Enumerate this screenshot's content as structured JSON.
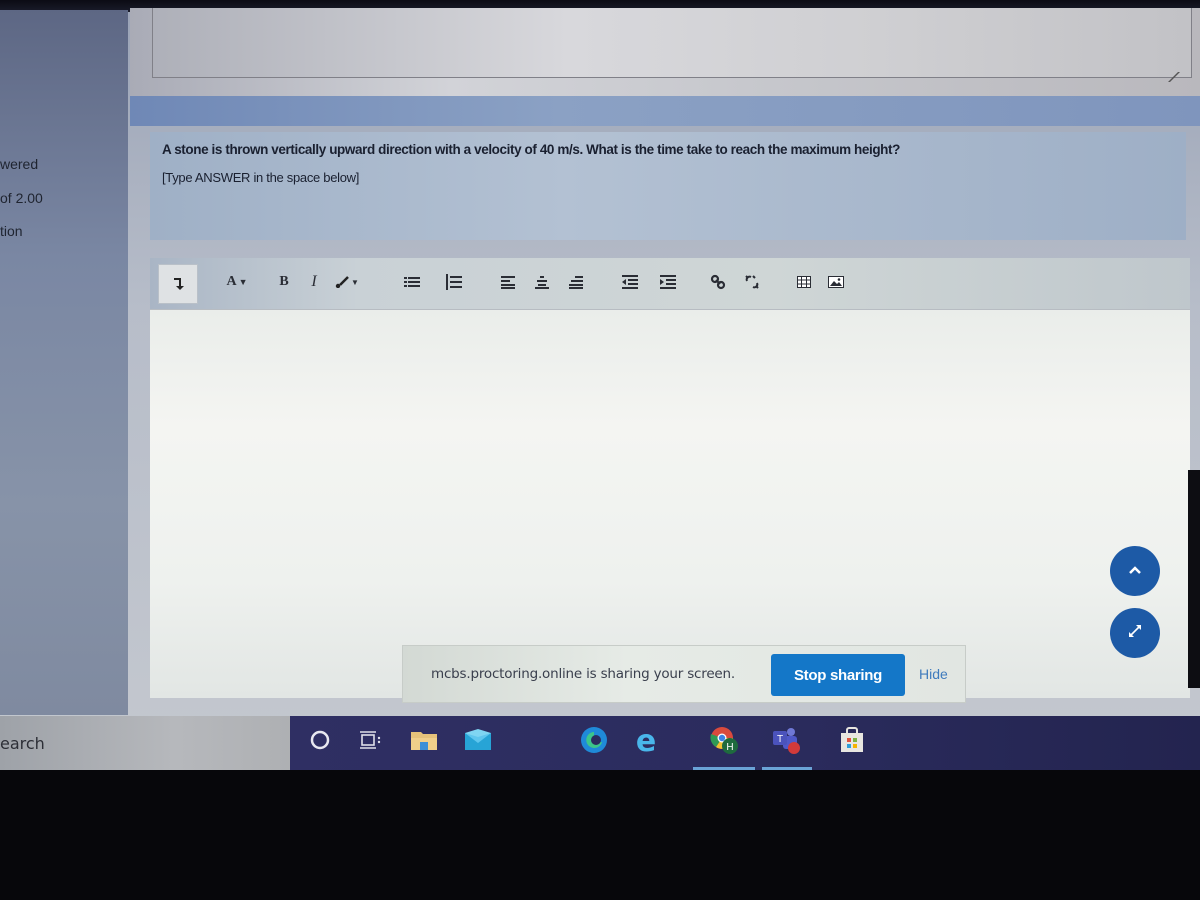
{
  "sidebar": {
    "status_fragment": "wered",
    "marks_fragment": "of 2.00",
    "flag_fragment": "tion"
  },
  "question": {
    "text": "A stone is thrown vertically upward direction with a velocity of 40 m/s. What is the time take to reach the maximum height?",
    "hint": "[Type ANSWER in the space below]"
  },
  "editor": {
    "answer_value": "",
    "toolbar": [
      {
        "name": "toolbar-toggle-button",
        "icon": "expand-toolbar-icon",
        "label": "↴"
      },
      {
        "name": "font-color-button",
        "icon": "font-color-icon",
        "label": "A▾"
      },
      {
        "name": "bold-button",
        "icon": "bold-icon",
        "label": "B"
      },
      {
        "name": "italic-button",
        "icon": "italic-icon",
        "label": "I"
      },
      {
        "name": "paint-style-button",
        "icon": "brush-icon",
        "label": "▾"
      },
      {
        "name": "unordered-list-button",
        "icon": "bullet-list-icon",
        "label": ""
      },
      {
        "name": "ordered-list-button",
        "icon": "numbered-list-icon",
        "label": ""
      },
      {
        "name": "align-left-button",
        "icon": "align-left-icon",
        "label": ""
      },
      {
        "name": "align-center-button",
        "icon": "align-center-icon",
        "label": ""
      },
      {
        "name": "align-right-button",
        "icon": "align-right-icon",
        "label": ""
      },
      {
        "name": "outdent-button",
        "icon": "outdent-icon",
        "label": ""
      },
      {
        "name": "indent-button",
        "icon": "indent-icon",
        "label": ""
      },
      {
        "name": "link-button",
        "icon": "link-icon",
        "label": ""
      },
      {
        "name": "unlink-button",
        "icon": "unlink-icon",
        "label": ""
      },
      {
        "name": "table-button",
        "icon": "table-icon",
        "label": ""
      },
      {
        "name": "image-button",
        "icon": "image-icon",
        "label": ""
      }
    ]
  },
  "floating_buttons": {
    "scroll_top_icon": "chevron-up-icon",
    "fullscreen_icon": "expand-diagonal-icon"
  },
  "share_bar": {
    "message": "mcbs.proctoring.online is sharing your screen.",
    "stop_label": "Stop sharing",
    "hide_label": "Hide"
  },
  "taskbar": {
    "search_label": "earch",
    "apps": [
      {
        "name": "cortana",
        "icon": "cortana-circle-icon"
      },
      {
        "name": "task-view",
        "icon": "task-view-icon"
      },
      {
        "name": "file-explorer",
        "icon": "folder-icon"
      },
      {
        "name": "mail",
        "icon": "mail-icon"
      },
      {
        "name": "edge",
        "icon": "edge-icon"
      },
      {
        "name": "internet-explorer",
        "icon": "internet-explorer-icon"
      },
      {
        "name": "chrome",
        "icon": "chrome-icon",
        "badge": "H",
        "active": true
      },
      {
        "name": "teams",
        "icon": "teams-icon",
        "active": true
      },
      {
        "name": "store",
        "icon": "store-icon"
      }
    ]
  },
  "colors": {
    "accent_blue": "#1477c8",
    "fab_blue": "#1d5aa6",
    "taskbar": "#2b2c5e"
  }
}
